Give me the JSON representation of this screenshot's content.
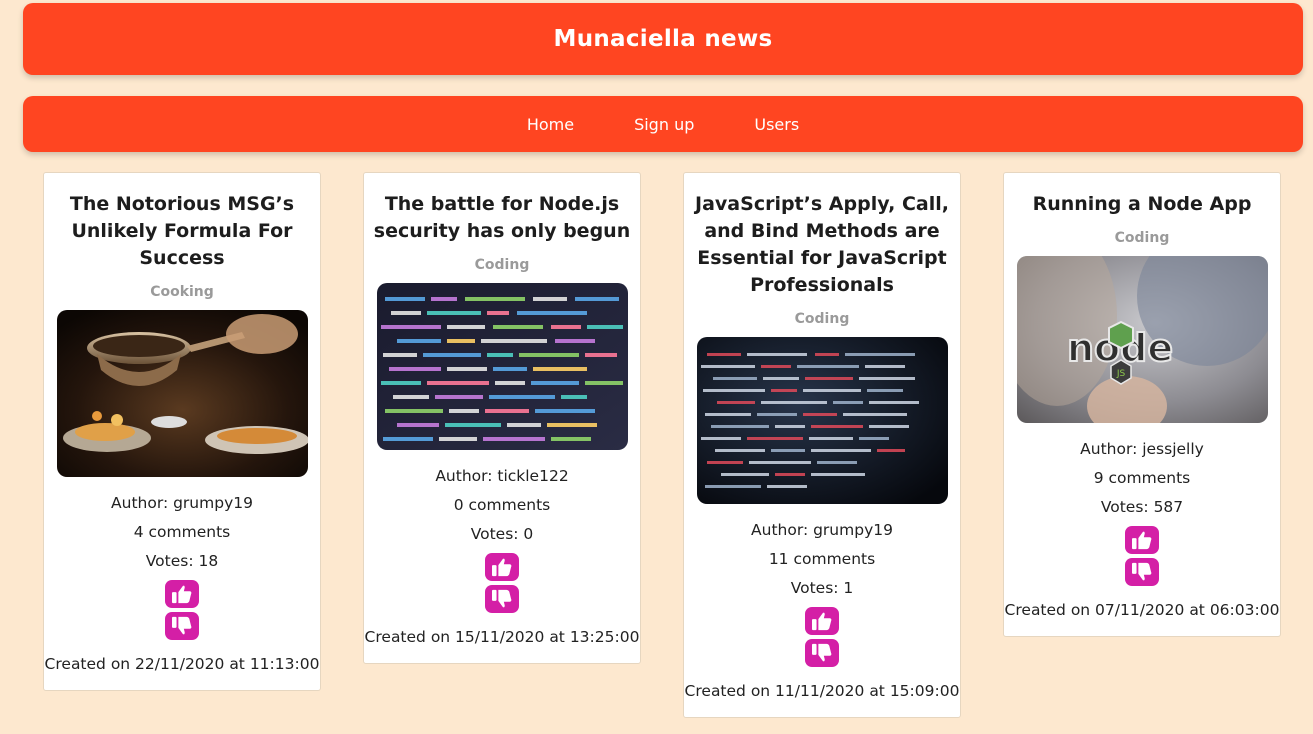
{
  "site": {
    "title": "Munaciella news"
  },
  "nav": {
    "items": [
      {
        "label": "Home"
      },
      {
        "label": "Sign up"
      },
      {
        "label": "Users"
      }
    ]
  },
  "colors": {
    "background": "#fde8cf",
    "brand": "#ff4521",
    "vote_button": "#d41fa6",
    "topic": "#9a9a9a"
  },
  "articles": [
    {
      "title": "The Notorious MSG’s Unlikely Formula For Success",
      "topic": "Cooking",
      "image": "cooking-pan-photo",
      "author": "Author: grumpy19",
      "comments": "4 comments",
      "votes": "Votes: 18",
      "created": "Created on 22/11/2020 at 11:13:00"
    },
    {
      "title": "The battle for Node.js security has only begun",
      "topic": "Coding",
      "image": "code-screen-photo",
      "author": "Author: tickle122",
      "comments": "0 comments",
      "votes": "Votes: 0",
      "created": "Created on 15/11/2020 at 13:25:00"
    },
    {
      "title": "JavaScript’s Apply, Call, and Bind Methods are Essential for JavaScript Professionals",
      "topic": "Coding",
      "image": "dark-code-screen-photo",
      "author": "Author: grumpy19",
      "comments": "11 comments",
      "votes": "Votes: 1",
      "created": "Created on 11/11/2020 at 15:09:00"
    },
    {
      "title": "Running a Node App",
      "topic": "Coding",
      "image": "nodejs-sticker-photo",
      "logo_text": "node",
      "logo_badge": "JS",
      "author": "Author: jessjelly",
      "comments": "9 comments",
      "votes": "Votes: 587",
      "created": "Created on 07/11/2020 at 06:03:00"
    }
  ],
  "icons": {
    "upvote": "thumbs-up-icon",
    "downvote": "thumbs-down-icon"
  }
}
